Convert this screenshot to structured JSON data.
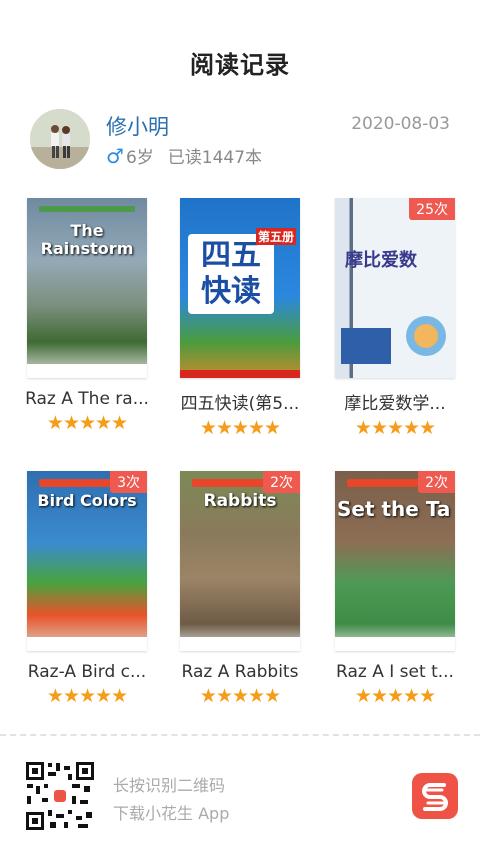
{
  "page": {
    "title": "阅读记录"
  },
  "user": {
    "name": "修小明",
    "gender_symbol": "♂",
    "age": "6岁",
    "read_count": "已读1447本",
    "date": "2020-08-03"
  },
  "books": [
    {
      "label": "Raz A   The ra...",
      "cover_text": "The Rainstorm",
      "badge": "",
      "stars": "★★★★★",
      "rating": 5
    },
    {
      "label": "四五快读(第5...",
      "cover_text": "四五快读",
      "cover_subtext": "第五册",
      "badge": "",
      "stars": "★★★★★",
      "rating": 5
    },
    {
      "label": "摩比爱数学...",
      "cover_text": "摩比爱数",
      "badge": "25次",
      "stars": "★★★★★",
      "rating": 5
    },
    {
      "label": "Raz-A   Bird c...",
      "cover_text": "Bird Colors",
      "badge": "3次",
      "stars": "★★★★★",
      "rating": 5
    },
    {
      "label": "Raz A   Rabbits",
      "cover_text": "Rabbits",
      "badge": "2次",
      "stars": "★★★★★",
      "rating": 5
    },
    {
      "label": "Raz A   I set t...",
      "cover_text": "Set the Ta",
      "badge": "2次",
      "stars": "★★★★★",
      "rating": 5
    }
  ],
  "footer": {
    "hint_line1": "长按识别二维码",
    "hint_line2": "下载小花生 App"
  },
  "colors": {
    "accent_orange": "#f59c1a",
    "badge_red": "#ef5a50",
    "name_blue": "#2a6fb0"
  }
}
